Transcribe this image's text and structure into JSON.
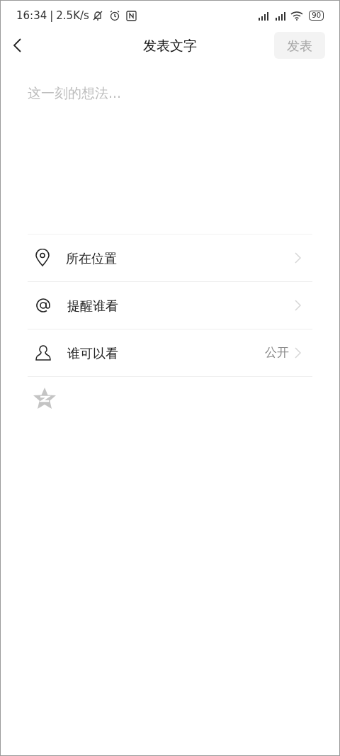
{
  "status_bar": {
    "time": "16:34",
    "separator": "|",
    "speed": "2.5K/s",
    "battery": "90"
  },
  "header": {
    "title": "发表文字",
    "post_button": {
      "label": "发表",
      "disabled": true
    }
  },
  "editor": {
    "placeholder": "这一刻的想法..."
  },
  "options": [
    {
      "kind": "location",
      "label": "所在位置"
    },
    {
      "kind": "mention",
      "label": "提醒谁看"
    },
    {
      "kind": "visibility",
      "label": "谁可以看",
      "value": "公开"
    }
  ],
  "share_toggle": {
    "on": false
  }
}
